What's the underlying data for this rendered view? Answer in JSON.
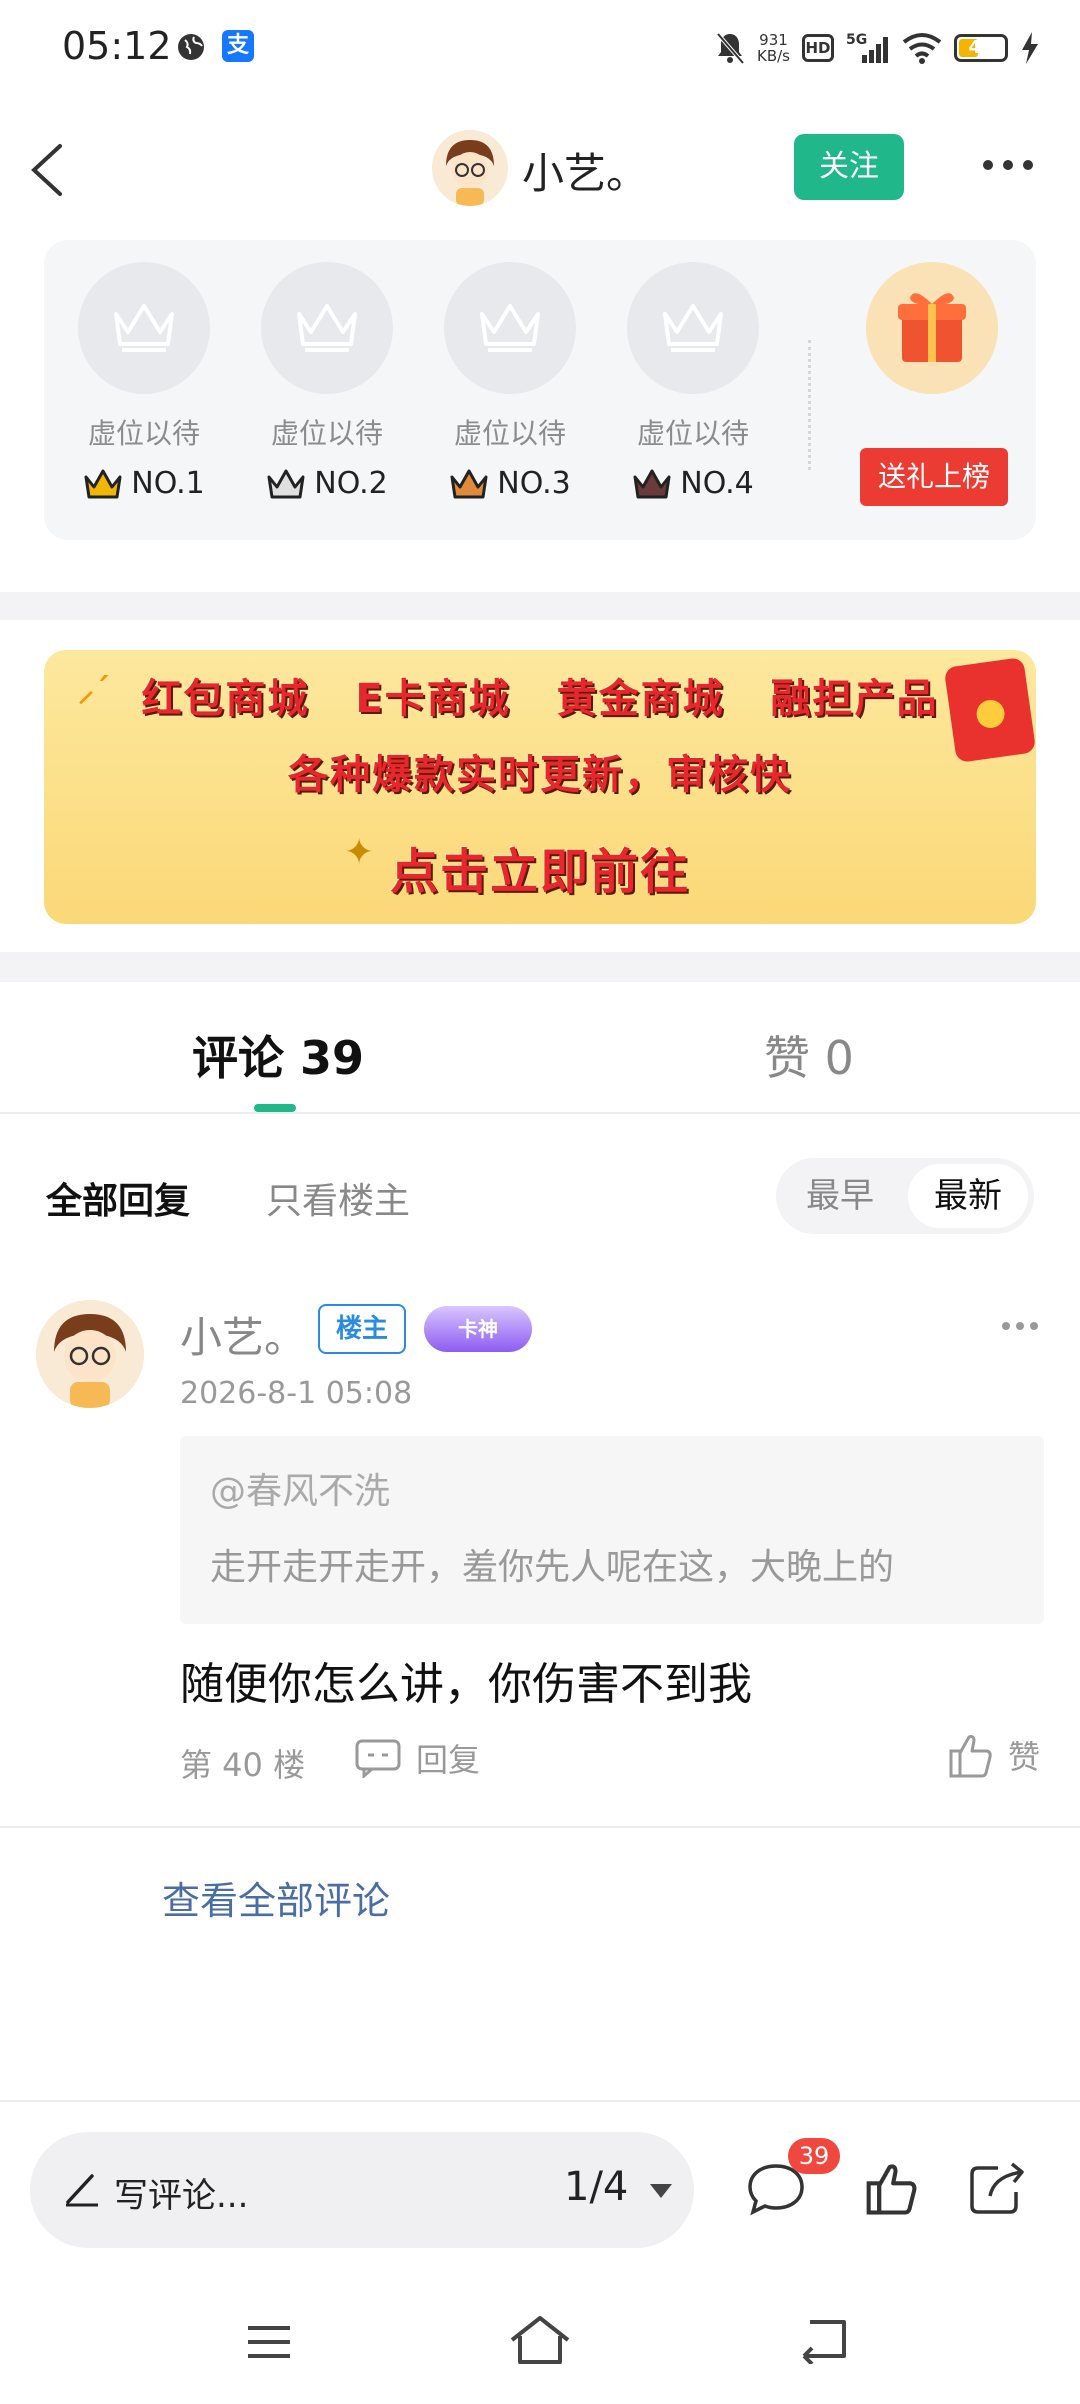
{
  "status_bar": {
    "time": "05:12",
    "alipay_glyph": "支",
    "net_speed_value": "931",
    "net_speed_unit": "KB/s",
    "hd_label": "HD",
    "network_label": "5G",
    "battery_level": "40",
    "icons": [
      "globe-icon",
      "alipay-icon",
      "mute-bell-icon",
      "hd-icon",
      "signal-icon",
      "wifi-icon",
      "battery-icon",
      "charging-icon"
    ]
  },
  "header": {
    "author_name": "小艺。",
    "follow_label": "关注"
  },
  "ranking": {
    "slots": [
      {
        "label": "虚位以待",
        "rank": "NO.1",
        "crown_color": "#f2b705"
      },
      {
        "label": "虚位以待",
        "rank": "NO.2",
        "crown_color": "#c9c9c9"
      },
      {
        "label": "虚位以待",
        "rank": "NO.3",
        "crown_color": "#e08b3a"
      },
      {
        "label": "虚位以待",
        "rank": "NO.4",
        "crown_color": "#6b3b3b"
      }
    ],
    "gift_button_label": "送礼上榜"
  },
  "ad_banner": {
    "line1": "红包商城 E卡商城 黄金商城 融担产品",
    "line2": "各种爆款实时更新，审核快",
    "line3": "点击立即前往"
  },
  "tabs": {
    "comments_label": "评论 39",
    "likes_label": "赞 0"
  },
  "filters": {
    "all_label": "全部回复",
    "op_only_label": "只看楼主",
    "sort_earliest": "最早",
    "sort_latest": "最新",
    "selected_sort": "最新"
  },
  "comment": {
    "author": "小艺。",
    "op_badge": "楼主",
    "level_badge": "卡神",
    "timestamp": "2026-8-1 05:08",
    "quote_user": "@春风不洗",
    "quote_text": "走开走开走开，羞你先人呢在这，大晚上的",
    "body": "随便你怎么讲，你伤害不到我",
    "floor": "第 40 楼",
    "reply_label": "回复",
    "like_label": "赞"
  },
  "view_all_label": "查看全部评论",
  "bottom_bar": {
    "input_placeholder": "写评论...",
    "page_indicator": "1/4",
    "comment_count": "39"
  },
  "colors": {
    "accent_green": "#20b78b",
    "gift_red": "#ec3b33",
    "link_blue": "#4a6ea3",
    "badge_red": "#f0473f"
  }
}
